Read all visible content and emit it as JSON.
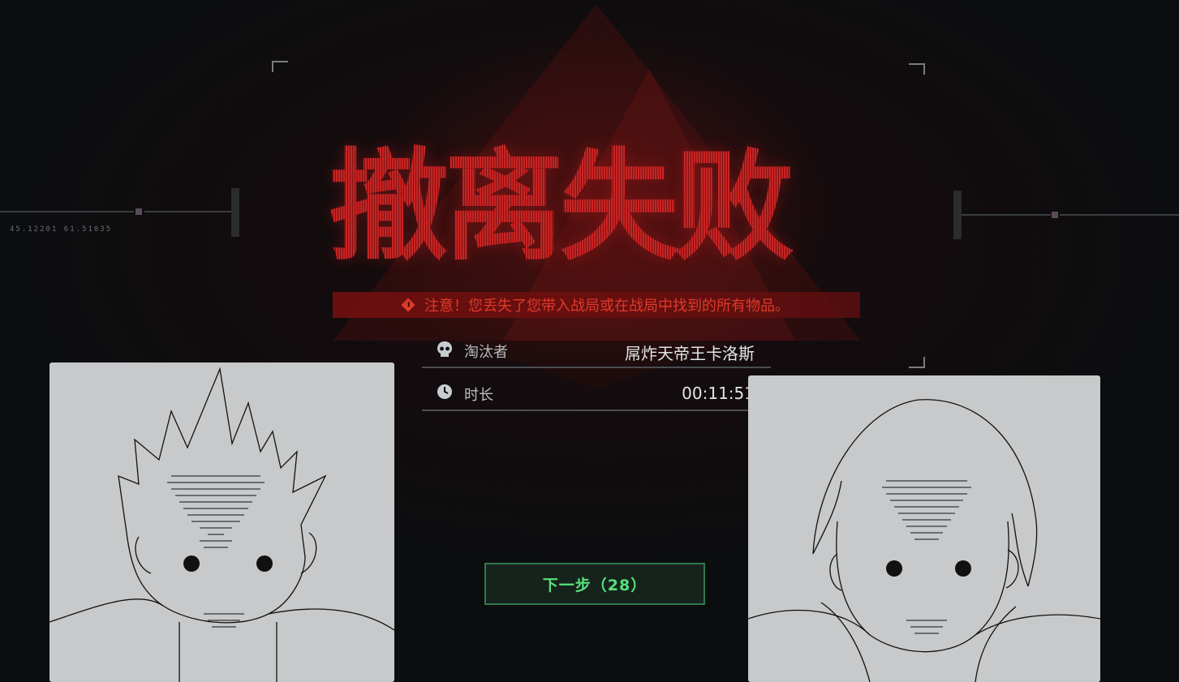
{
  "title": "撤离失败",
  "warning": "注意！您丢失了您带入战局或在战局中找到的所有物品。",
  "info": [
    {
      "icon": "skull-icon",
      "label": "淘汰者",
      "value": "屌炸天帝王卡洛斯"
    },
    {
      "icon": "clock-icon",
      "label": "时长",
      "value": "00:11:51"
    }
  ],
  "next_button": "下一步（28）",
  "hud": {
    "coords": "45.12201   61.51035"
  },
  "colors": {
    "title_red": "#b42424",
    "warning_red": "#e03a2a",
    "button_green": "#57e07c"
  }
}
